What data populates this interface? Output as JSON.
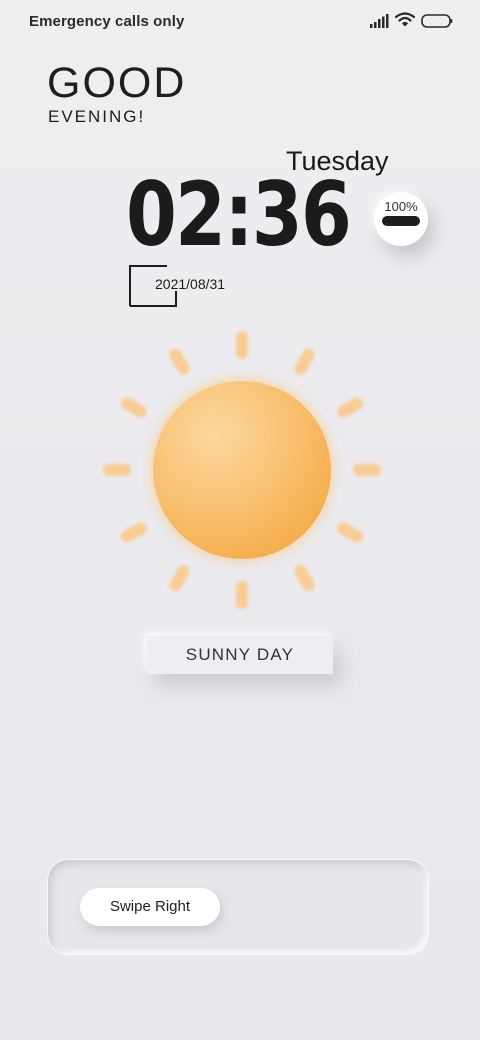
{
  "status_bar": {
    "carrier_text": "Emergency calls only",
    "icons": [
      "signal-icon",
      "wifi-icon",
      "battery-icon"
    ]
  },
  "greeting": {
    "line1": "GOOD",
    "line2": "EVENING!"
  },
  "clock": {
    "weekday": "Tuesday",
    "time": "02:36",
    "date": "2021/08/31"
  },
  "battery": {
    "percent": "100%",
    "level": 1.0
  },
  "weather": {
    "icon": "sun-icon",
    "condition": "SUNNY DAY",
    "colors": {
      "sun_core": "#f8be6c",
      "sun_ray": "#f9c98a"
    }
  },
  "unlock": {
    "swipe_label": "Swipe Right"
  }
}
